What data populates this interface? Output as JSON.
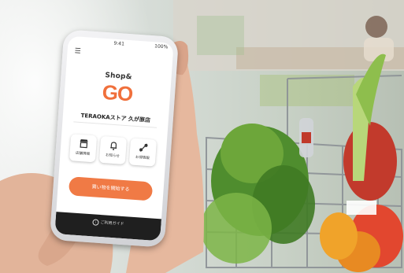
{
  "app": {
    "status_time": "9:41",
    "battery": "100%",
    "menu_icon": "hamburger-icon",
    "logo_top": "Shop&",
    "logo_main": "GO",
    "store_name": "TERAOKAストア 久が原店",
    "buttons": [
      {
        "label": "店舗情報",
        "icon": "store-icon"
      },
      {
        "label": "お知らせ",
        "icon": "bell-icon"
      },
      {
        "label": "お得情報",
        "icon": "coupon-icon"
      }
    ],
    "start_button": "買い物を開始する",
    "guide_label": "ご利用ガイド"
  },
  "colors": {
    "accent": "#f0703c",
    "start_bg": "#f07a45",
    "guide_bg": "#1f1f1f"
  }
}
